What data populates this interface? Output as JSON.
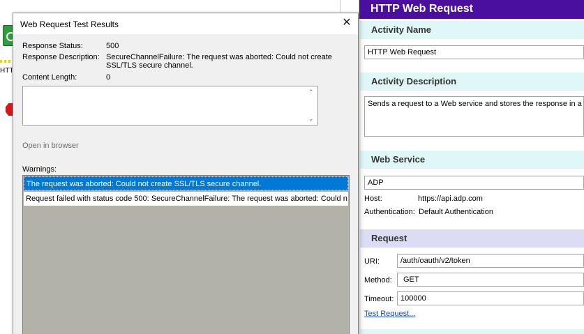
{
  "canvas": {
    "activity_label": "HTTP Request"
  },
  "dialog": {
    "title": "Web Request Test Results",
    "close_glyph": "✕",
    "fields": {
      "response_status_label": "Response Status:",
      "response_status_value": "500",
      "response_description_label": "Response Description:",
      "response_description_value": "SecureChannelFailure: The request was aborted: Could not create SSL/TLS secure channel.",
      "content_length_label": "Content Length:",
      "content_length_value": "0"
    },
    "content_value": "",
    "open_in_browser": "Open in browser",
    "warnings_label": "Warnings:",
    "warnings": [
      "The request was aborted: Could not create SSL/TLS secure channel.",
      "Request failed with status code 500: SecureChannelFailure: The request was aborted: Could n..."
    ]
  },
  "panel": {
    "title": "HTTP Web Request",
    "activity_name_header": "Activity Name",
    "activity_name_value": "HTTP Web Request",
    "activity_description_header": "Activity Description",
    "activity_description_value": "Sends a request to a Web service and stores the response in a tok",
    "web_service_header": "Web Service",
    "web_service_value": "ADP",
    "host_label": "Host:",
    "host_value": "https://api.adp.com",
    "authentication_label": "Authentication:",
    "authentication_value": "Default Authentication",
    "request_header": "Request",
    "uri_label": "URI:",
    "uri_value": "/auth/oauth/v2/token",
    "method_label": "Method:",
    "method_value": "GET",
    "timeout_label": "Timeout:",
    "timeout_value": "100000",
    "test_request_link": "Test Request..."
  },
  "colors": {
    "panel_title_bg": "#4b0fa0",
    "section_header_bg": "#dff7f7",
    "request_header_bg": "#dcdcf5",
    "selection_bg": "#0078d7",
    "warnings_empty_bg": "#b3b2a9",
    "link": "#1a4ad6"
  },
  "icons": {
    "close": "close-icon",
    "start_activity": "start-activity-icon",
    "stop_activity": "stop-activity-icon",
    "scroll_up": "scroll-up-icon",
    "scroll_down": "scroll-down-icon"
  }
}
